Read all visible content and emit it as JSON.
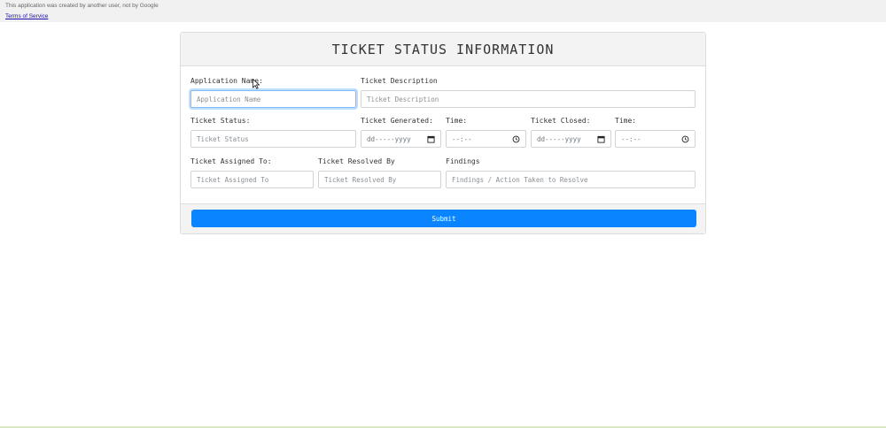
{
  "notice_bar": {
    "notice": "This application was created by another user, not by Google",
    "terms_link": "Terms of Service"
  },
  "form": {
    "title": "TICKET STATUS INFORMATION",
    "application_name": {
      "label": "Application Name:",
      "placeholder": "Application Name"
    },
    "ticket_description": {
      "label": "Ticket Description",
      "placeholder": "Ticket Description"
    },
    "ticket_status": {
      "label": "Ticket Status:",
      "placeholder": "Ticket Status"
    },
    "ticket_generated": {
      "label": "Ticket Generated:",
      "placeholder": "dd-----yyyy"
    },
    "generated_time": {
      "label": "Time:",
      "placeholder": "--:--"
    },
    "ticket_closed": {
      "label": "Ticket Closed:",
      "placeholder": "dd-----yyyy"
    },
    "closed_time": {
      "label": "Time:",
      "placeholder": "--:--"
    },
    "assigned_to": {
      "label": "Ticket Assigned To:",
      "placeholder": "Ticket Assigned To"
    },
    "resolved_by": {
      "label": "Ticket Resolved By",
      "placeholder": "Ticket Resolved By"
    },
    "findings": {
      "label": "Findings",
      "placeholder": "Findings / Action Taken to Resolve"
    },
    "submit_label": "Submit"
  },
  "icons": {
    "date_picker": "calendar-icon",
    "time_picker": "clock-icon"
  },
  "colors": {
    "submit_button": "#0b84ff",
    "header_bg": "#f3f3f4",
    "focus_border": "#80bdff"
  }
}
